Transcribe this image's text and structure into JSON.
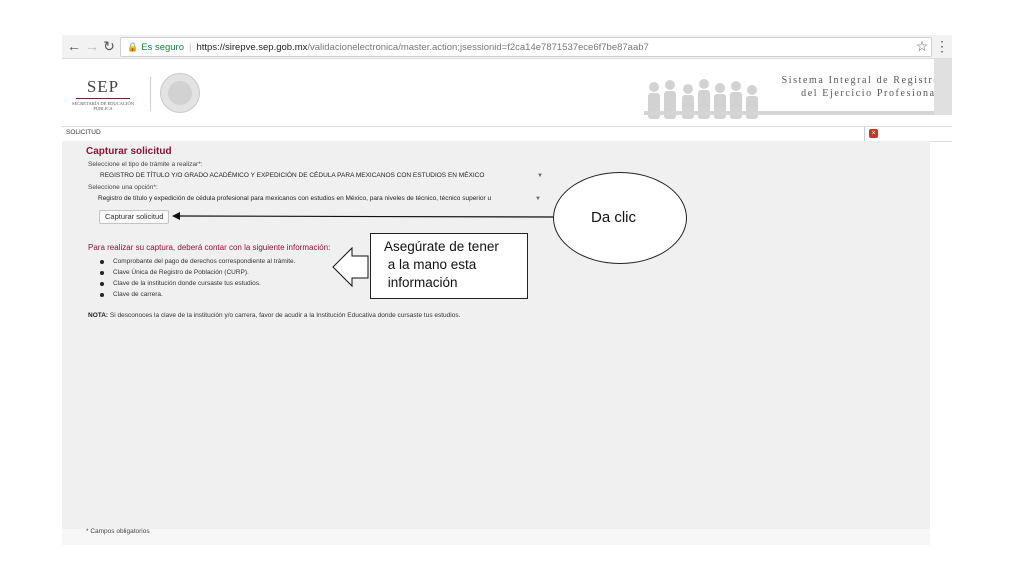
{
  "browser": {
    "security_label": "Es seguro",
    "url_host": "https://sirepve.sep.gob.mx",
    "url_path": "/validacionelectronica/master.action;jsessionid=f2ca14e7871537ece6f7be87aab7"
  },
  "header": {
    "logo_text": "SEP",
    "logo_subtitle": "SECRETARÍA DE EDUCACIÓN PÚBLICA",
    "system_title_line1": "Sistema Integral de Registro",
    "system_title_line2": "del Ejercicio Profesional"
  },
  "breadcrumb": "SOLICITUD",
  "form": {
    "title": "Capturar solicitud",
    "tramite_label": "Seleccione el tipo de trámite a realizar*:",
    "tramite_value": "REGISTRO DE TÍTULO Y/O GRADO ACADÉMICO Y EXPEDICIÓN DE CÉDULA PARA MEXICANOS CON ESTUDIOS EN MÉXICO",
    "opcion_label": "Seleccione una opción*:",
    "opcion_value": "Registro de título y expedición de cédula profesional para mexicanos con estudios en México, para niveles de técnico, técnico superior u",
    "submit_label": "Capturar solicitud"
  },
  "info": {
    "title": "Para realizar su captura, deberá contar con la siguiente información:",
    "items": [
      "Comprobante del pago de derechos correspondiente al trámite.",
      "Clave Única de Registro de Población (CURP).",
      "Clave de la institución donde cursaste tus estudios.",
      "Clave de carrera."
    ],
    "nota_label": "NOTA:",
    "nota_text": " Si desconoces la clave de la institución y/o carrera, favor de acudir a la Institución Educativa donde cursaste tus estudios."
  },
  "footer": {
    "required_note": "* Campos obligatorios"
  },
  "annotations": {
    "callout_click": "Da clic",
    "callout_info": "Asegúrate de tener\n a la mano esta\n información"
  },
  "colors": {
    "brand": "#8a1538",
    "secure": "#188038"
  }
}
